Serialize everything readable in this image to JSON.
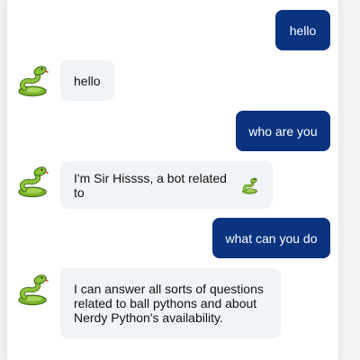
{
  "conversation": {
    "messages": [
      {
        "sender": "user",
        "text": "hello"
      },
      {
        "sender": "bot",
        "avatar_icon": "snake-emoji-icon",
        "text": "hello"
      },
      {
        "sender": "user",
        "text": "who are you"
      },
      {
        "sender": "bot",
        "avatar_icon": "snake-emoji-icon",
        "text": "I'm Sir Hissss, a bot related to",
        "trailing_icon": "snake-emoji-icon"
      },
      {
        "sender": "user",
        "text": "what can you do"
      },
      {
        "sender": "bot",
        "avatar_icon": "snake-emoji-icon",
        "text": "I can answer all sorts of questions related to ball pythons and about Nerdy Python's availability."
      }
    ]
  },
  "colors": {
    "user_bubble": "#0a3380",
    "bot_bubble": "#f1f4f7",
    "panel_bg": "#ffffff",
    "page_bg": "#f3f3f3"
  }
}
